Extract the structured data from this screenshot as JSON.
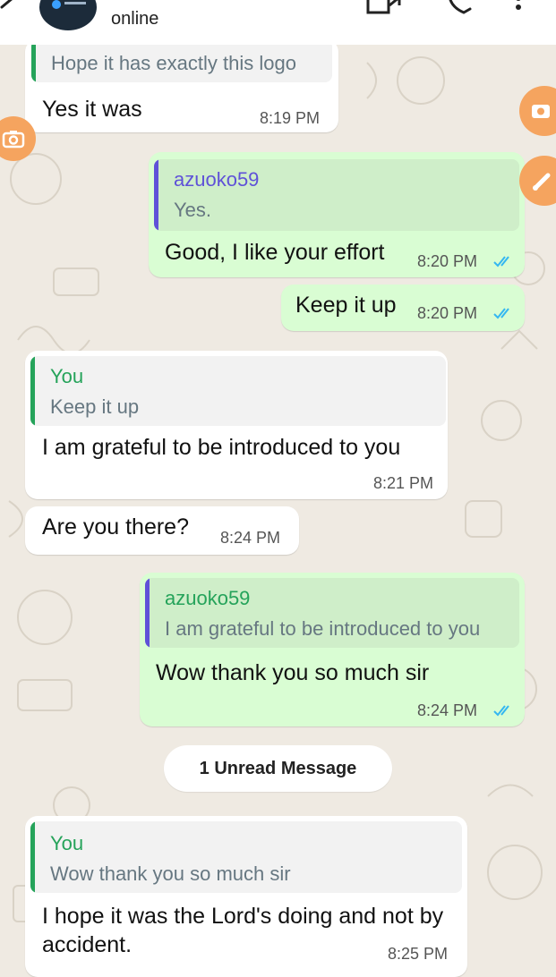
{
  "header": {
    "status": "online"
  },
  "messages": [
    {
      "quote_text": "Hope it has exactly this logo",
      "text": "Yes it was",
      "time": "8:19 PM"
    },
    {
      "quote_author": "azuoko59",
      "quote_text": "Yes.",
      "text": "Good, I like your effort",
      "time": "8:20 PM"
    },
    {
      "text": "Keep it up",
      "time": "8:20 PM"
    },
    {
      "quote_author": "You",
      "quote_text": "Keep it up",
      "text": "I am grateful to be introduced to you",
      "time": "8:21 PM"
    },
    {
      "text": "Are you there?",
      "time": "8:24 PM"
    },
    {
      "quote_author": "azuoko59",
      "quote_text": "I am grateful to be introduced to you",
      "text": "Wow thank you so much sir",
      "time": "8:24 PM"
    },
    {
      "quote_author": "You",
      "quote_text": "Wow thank you so much sir",
      "text": "I hope it was the Lord's doing and not by accident.",
      "time": "8:25 PM"
    }
  ],
  "unread_label": "1 Unread Message",
  "colors": {
    "chat_background": "#efeae2",
    "incoming_bubble": "#ffffff",
    "outgoing_bubble": "#d9fdd3",
    "quote_you": "#25a35a",
    "quote_other": "#5f51d8",
    "read_ticks": "#34b7f1",
    "floating_buttons": "#f5a45f"
  },
  "icons": [
    "back-arrow-icon",
    "video-call-icon",
    "phone-icon",
    "more-options-icon",
    "camera-icon",
    "read-receipt-icon",
    "edit-pencil-icon"
  ]
}
